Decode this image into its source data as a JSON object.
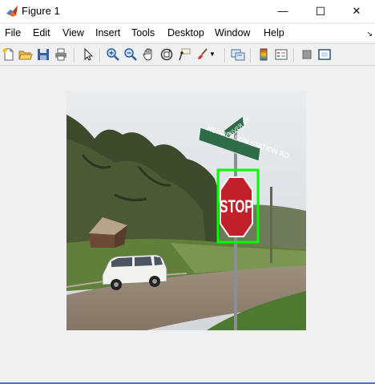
{
  "window": {
    "title": "Figure 1",
    "minimize_glyph": "—",
    "maximize_glyph": "☐",
    "close_glyph": "✕"
  },
  "menu": [
    {
      "label": "File"
    },
    {
      "label": "Edit"
    },
    {
      "label": "View"
    },
    {
      "label": "Insert"
    },
    {
      "label": "Tools"
    },
    {
      "label": "Desktop"
    },
    {
      "label": "Window"
    },
    {
      "label": "Help"
    }
  ],
  "toolbar": {
    "buttons": [
      "new-figure-icon",
      "open-file-icon",
      "save-icon",
      "print-icon",
      "pointer-icon",
      "zoom-in-icon",
      "zoom-out-icon",
      "pan-hand-icon",
      "rotate-3d-icon",
      "data-cursor-icon",
      "brush-icon",
      "link-plot-icon",
      "colorbar-icon",
      "legend-icon",
      "hide-plot-tools-icon",
      "show-plot-tools-icon"
    ]
  },
  "image": {
    "content": "photo",
    "sign_text": {
      "stop": "STOP",
      "street_top": "RIVER ST",
      "street_main": "HENDERSON STATION RD"
    },
    "box_color": "#00ff00"
  },
  "colors": {
    "accent_bottom": "#3b79c6",
    "matlab_icon": "#e8702a"
  }
}
